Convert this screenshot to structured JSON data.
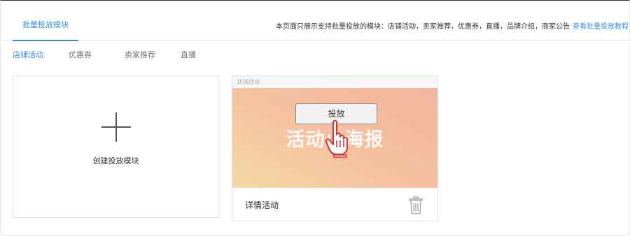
{
  "header": {
    "tab_label": "批量投放模块",
    "notice": "本页面只展示支持批量投放的模块：店铺活动，卖家推荐，优惠券，直播，品牌介绍，商家公告",
    "notice_link": "查看批量投放教程"
  },
  "sub_tabs": [
    {
      "label": "店铺活动",
      "active": true
    },
    {
      "label": "优惠券",
      "active": false
    },
    {
      "label": "卖家推荐",
      "active": false
    },
    {
      "label": "直播",
      "active": false
    }
  ],
  "create_card": {
    "label": "创建投放模块",
    "icon": "plus-icon"
  },
  "poster_card": {
    "header_label": "店铺活动",
    "poster_text": "活动小海报",
    "launch_button": "投放",
    "title": "详情活动",
    "icons": [
      "hand-pointer-icon",
      "trash-icon"
    ]
  },
  "colors": {
    "accent": "#3a8ee6",
    "poster_gradient": [
      "#f4d9a6",
      "#f3b49f"
    ],
    "hand_outline": "#d9302c"
  }
}
